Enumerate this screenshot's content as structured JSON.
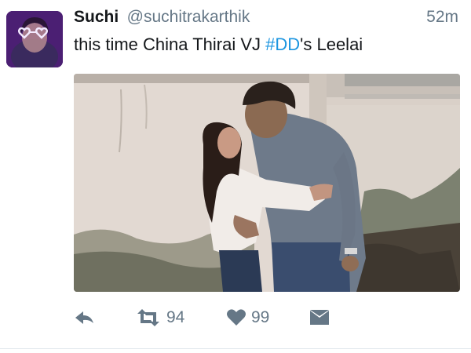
{
  "tweet": {
    "author": {
      "display_name": "Suchi",
      "username": "@suchitrakarthik",
      "avatar_icon": "profile-photo-heart-glasses"
    },
    "timestamp": "52m",
    "text_before": "this time China Thirai VJ ",
    "hashtag": "#DD",
    "text_after": "'s Leelai",
    "media": {
      "kind": "photo"
    },
    "actions": {
      "reply_icon": "reply-icon",
      "retweet_icon": "retweet-icon",
      "retweet_count": "94",
      "like_icon": "heart-icon",
      "like_count": "99",
      "dm_icon": "envelope-icon"
    }
  },
  "colors": {
    "text": "#14171a",
    "muted": "#657786",
    "hashtag": "#1b95e0",
    "icon": "#657786"
  }
}
